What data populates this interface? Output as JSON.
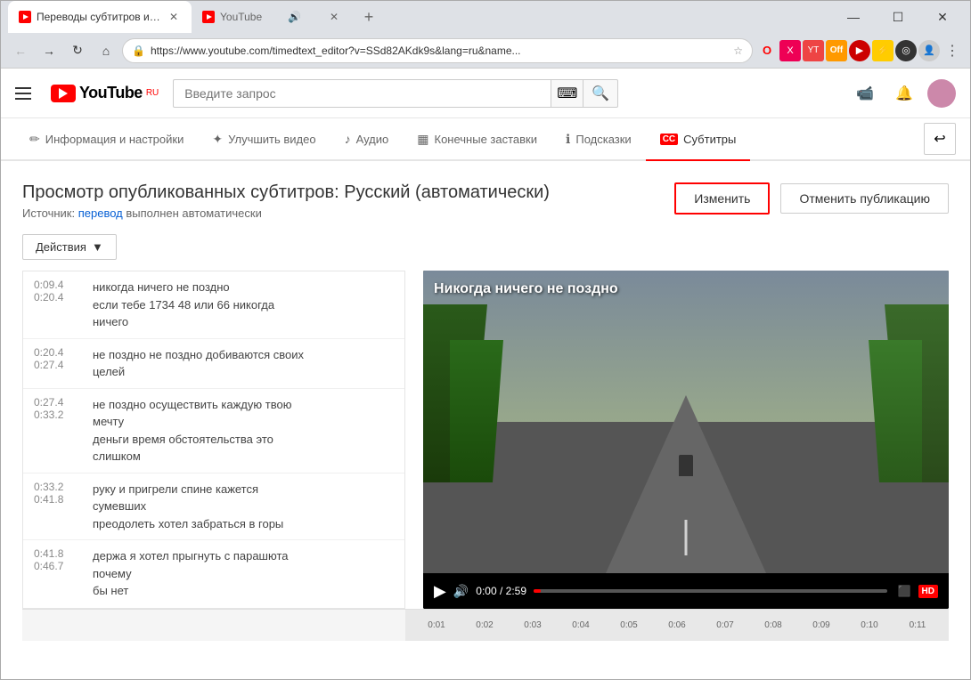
{
  "browser": {
    "tabs": [
      {
        "id": "tab1",
        "icon": "yt-icon",
        "title": "Переводы субтитров и метадан...",
        "active": true
      },
      {
        "id": "tab2",
        "icon": "yt-icon",
        "title": "YouTube",
        "active": false
      }
    ],
    "url": "https://www.youtube.com/timedtext_editor?v=SSd82AKdk9s&lang=ru&name...",
    "window_controls": {
      "minimize": "—",
      "maximize": "☐",
      "close": "✕"
    }
  },
  "youtube": {
    "logo_text": "YouTube",
    "logo_ru": "RU",
    "search_placeholder": "Введите запрос",
    "nav_items": [
      {
        "id": "info",
        "label": "Информация и настройки",
        "icon": "✏️",
        "active": false
      },
      {
        "id": "improve",
        "label": "Улучшить видео",
        "icon": "✨",
        "active": false
      },
      {
        "id": "audio",
        "label": "Аудио",
        "icon": "♪",
        "active": false
      },
      {
        "id": "end",
        "label": "Конечные заставки",
        "icon": "⬛",
        "active": false
      },
      {
        "id": "hints",
        "label": "Подсказки",
        "icon": "ℹ️",
        "active": false
      },
      {
        "id": "subtitles",
        "label": "Субтитры",
        "icon": "CC",
        "active": true
      }
    ],
    "back_button": "↩"
  },
  "page": {
    "title": "Просмотр опубликованных субтитров: Русский (автоматически)",
    "source_label": "Источник:",
    "source_link": "перевод",
    "source_suffix": "выполнен автоматически",
    "btn_change": "Изменить",
    "btn_cancel_pub": "Отменить публикацию",
    "btn_actions": "Действия",
    "actions_arrow": "▼"
  },
  "subtitles": [
    {
      "time_start": "0:09.4",
      "time_end": "0:20.4",
      "text": "никогда ничего не поздно если тебе 1734 48 или 66 никогда ничего"
    },
    {
      "time_start": "0:20.4",
      "time_end": "0:27.4",
      "text": "не поздно не поздно добиваются своих целей"
    },
    {
      "time_start": "0:27.4",
      "time_end": "0:33.2",
      "text": "не поздно осуществить каждую твою мечту деньги время обстоятельства это слишком"
    },
    {
      "time_start": "0:33.2",
      "time_end": "0:41.8",
      "text": "руку и пригрели спине кажется сумевших преодолеть хотел забраться в горы"
    },
    {
      "time_start": "0:41.8",
      "time_end": "0:46.7",
      "text": "держа я хотел прыгнуть с парашюта почему бы нет"
    }
  ],
  "video": {
    "title": "Никогда ничего не поздно",
    "time_current": "0:00",
    "time_total": "2:59",
    "quality": "HD"
  },
  "timeline": {
    "ticks": [
      "0:01",
      "0:02",
      "0:03",
      "0:04",
      "0:05",
      "0:06",
      "0:07",
      "0:08",
      "0:09",
      "0:10",
      "0:11"
    ]
  }
}
